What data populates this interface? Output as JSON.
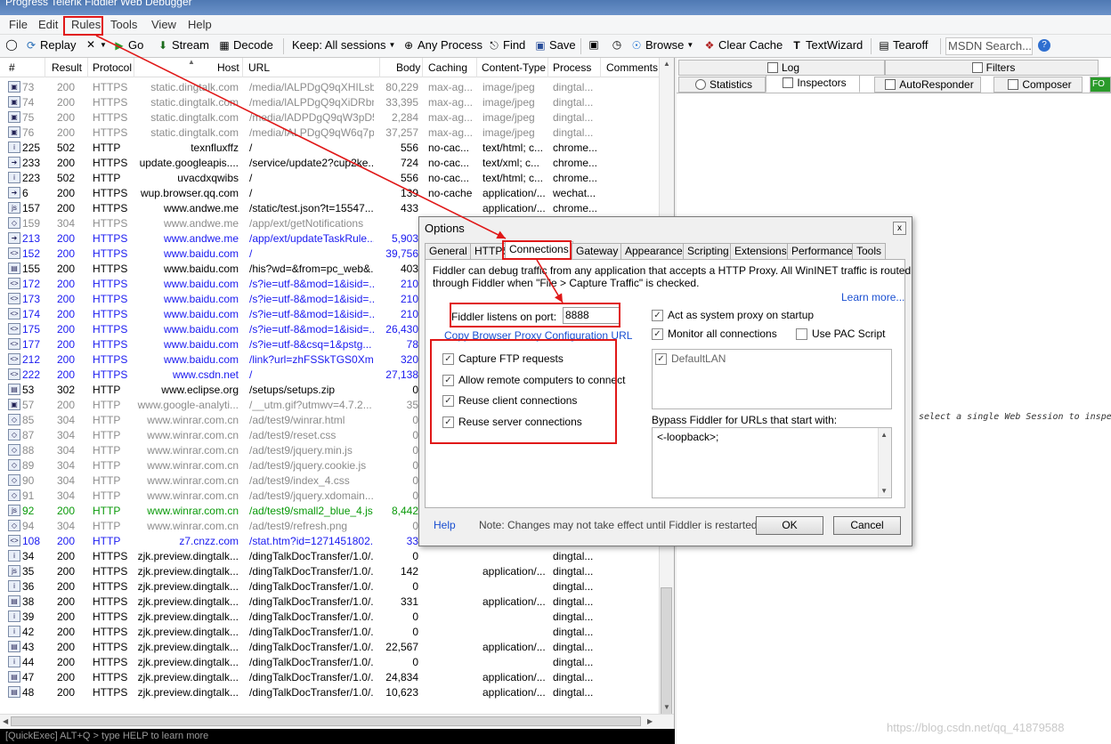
{
  "window": {
    "title": "Progress Telerik Fiddler Web Debugger"
  },
  "menu": [
    "File",
    "Edit",
    "Rules",
    "Tools",
    "View",
    "Help"
  ],
  "toolbar": {
    "replay": "Replay",
    "go": "Go",
    "stream": "Stream",
    "decode": "Decode",
    "keep": "Keep: All sessions",
    "process": "Any Process",
    "find": "Find",
    "save": "Save",
    "browse": "Browse",
    "clear_cache": "Clear Cache",
    "textwizard": "TextWizard",
    "tearoff": "Tearoff",
    "msdn": "MSDN Search..."
  },
  "columns": [
    "#",
    "Result",
    "Protocol",
    "Host",
    "URL",
    "Body",
    "Caching",
    "Content-Type",
    "Process",
    "Comments"
  ],
  "sessions": [
    {
      "num": "73",
      "result": "200",
      "protocol": "HTTPS",
      "host": "static.dingtalk.com",
      "url": "/media/lALPDgQ9qXHILsb...",
      "body": "80,229",
      "caching": "max-ag...",
      "ctype": "image/jpeg",
      "process": "dingtal...",
      "color": "gray",
      "icon": "img"
    },
    {
      "num": "74",
      "result": "200",
      "protocol": "HTTPS",
      "host": "static.dingtalk.com",
      "url": "/media/lALPDgQ9qXiDRbn...",
      "body": "33,395",
      "caching": "max-ag...",
      "ctype": "image/jpeg",
      "process": "dingtal...",
      "color": "gray",
      "icon": "img"
    },
    {
      "num": "75",
      "result": "200",
      "protocol": "HTTPS",
      "host": "static.dingtalk.com",
      "url": "/media/lADPDgQ9qW3pD5...",
      "body": "2,284",
      "caching": "max-ag...",
      "ctype": "image/jpeg",
      "process": "dingtal...",
      "color": "gray",
      "icon": "img"
    },
    {
      "num": "76",
      "result": "200",
      "protocol": "HTTPS",
      "host": "static.dingtalk.com",
      "url": "/media/lALPDgQ9qW6q7p...",
      "body": "37,257",
      "caching": "max-ag...",
      "ctype": "image/jpeg",
      "process": "dingtal...",
      "color": "gray",
      "icon": "img"
    },
    {
      "num": "225",
      "result": "502",
      "protocol": "HTTP",
      "host": "texnfluxffz",
      "url": "/",
      "body": "556",
      "caching": "no-cac...",
      "ctype": "text/html; c...",
      "process": "chrome...",
      "color": "black",
      "icon": "i"
    },
    {
      "num": "233",
      "result": "200",
      "protocol": "HTTPS",
      "host": "update.googleapis....",
      "url": "/service/update2?cup2ke...",
      "body": "724",
      "caching": "no-cac...",
      "ctype": "text/xml; c...",
      "process": "chrome...",
      "color": "black",
      "icon": "arrow"
    },
    {
      "num": "223",
      "result": "502",
      "protocol": "HTTP",
      "host": "uvacdxqwibs",
      "url": "/",
      "body": "556",
      "caching": "no-cac...",
      "ctype": "text/html; c...",
      "process": "chrome...",
      "color": "black",
      "icon": "i"
    },
    {
      "num": "6",
      "result": "200",
      "protocol": "HTTPS",
      "host": "wup.browser.qq.com",
      "url": "/",
      "body": "139",
      "caching": "no-cache",
      "ctype": "application/...",
      "process": "wechat...",
      "color": "black",
      "icon": "arrow"
    },
    {
      "num": "157",
      "result": "200",
      "protocol": "HTTPS",
      "host": "www.andwe.me",
      "url": "/static/test.json?t=15547...",
      "body": "433",
      "caching": "",
      "ctype": "application/...",
      "process": "chrome...",
      "color": "black",
      "icon": "js"
    },
    {
      "num": "159",
      "result": "304",
      "protocol": "HTTPS",
      "host": "www.andwe.me",
      "url": "/app/ext/getNotifications",
      "body": "",
      "caching": "",
      "ctype": "",
      "process": "",
      "color": "gray",
      "icon": "diamond"
    },
    {
      "num": "213",
      "result": "200",
      "protocol": "HTTPS",
      "host": "www.andwe.me",
      "url": "/app/ext/updateTaskRule...",
      "body": "5,903",
      "caching": "",
      "ctype": "",
      "process": "",
      "color": "blue",
      "icon": "arrow"
    },
    {
      "num": "152",
      "result": "200",
      "protocol": "HTTPS",
      "host": "www.baidu.com",
      "url": "/",
      "body": "39,756",
      "caching": "",
      "ctype": "",
      "process": "",
      "color": "blue",
      "icon": "code"
    },
    {
      "num": "155",
      "result": "200",
      "protocol": "HTTPS",
      "host": "www.baidu.com",
      "url": "/his?wd=&from=pc_web&...",
      "body": "403",
      "caching": "",
      "ctype": "",
      "process": "",
      "color": "black",
      "icon": "doc"
    },
    {
      "num": "172",
      "result": "200",
      "protocol": "HTTPS",
      "host": "www.baidu.com",
      "url": "/s?ie=utf-8&mod=1&isid=...",
      "body": "210",
      "caching": "",
      "ctype": "",
      "process": "",
      "color": "blue",
      "icon": "code"
    },
    {
      "num": "173",
      "result": "200",
      "protocol": "HTTPS",
      "host": "www.baidu.com",
      "url": "/s?ie=utf-8&mod=1&isid=...",
      "body": "210",
      "caching": "",
      "ctype": "",
      "process": "",
      "color": "blue",
      "icon": "code"
    },
    {
      "num": "174",
      "result": "200",
      "protocol": "HTTPS",
      "host": "www.baidu.com",
      "url": "/s?ie=utf-8&mod=1&isid=...",
      "body": "210",
      "caching": "",
      "ctype": "",
      "process": "",
      "color": "blue",
      "icon": "code"
    },
    {
      "num": "175",
      "result": "200",
      "protocol": "HTTPS",
      "host": "www.baidu.com",
      "url": "/s?ie=utf-8&mod=1&isid=...",
      "body": "26,430",
      "caching": "",
      "ctype": "",
      "process": "",
      "color": "blue",
      "icon": "code"
    },
    {
      "num": "177",
      "result": "200",
      "protocol": "HTTPS",
      "host": "www.baidu.com",
      "url": "/s?ie=utf-8&csq=1&pstg...",
      "body": "78",
      "caching": "",
      "ctype": "",
      "process": "",
      "color": "blue",
      "icon": "code"
    },
    {
      "num": "212",
      "result": "200",
      "protocol": "HTTPS",
      "host": "www.baidu.com",
      "url": "/link?url=zhFSSkTGS0XmG...",
      "body": "320",
      "caching": "",
      "ctype": "",
      "process": "",
      "color": "blue",
      "icon": "code"
    },
    {
      "num": "222",
      "result": "200",
      "protocol": "HTTPS",
      "host": "www.csdn.net",
      "url": "/",
      "body": "27,138",
      "caching": "",
      "ctype": "",
      "process": "",
      "color": "blue",
      "icon": "code"
    },
    {
      "num": "53",
      "result": "302",
      "protocol": "HTTP",
      "host": "www.eclipse.org",
      "url": "/setups/setups.zip",
      "body": "0",
      "caching": "",
      "ctype": "",
      "process": "",
      "color": "black",
      "icon": "doc"
    },
    {
      "num": "57",
      "result": "200",
      "protocol": "HTTP",
      "host": "www.google-analyti...",
      "url": "/__utm.gif?utmwv=4.7.2...",
      "body": "35",
      "caching": "",
      "ctype": "",
      "process": "",
      "color": "gray",
      "icon": "img"
    },
    {
      "num": "85",
      "result": "304",
      "protocol": "HTTP",
      "host": "www.winrar.com.cn",
      "url": "/ad/test9/winrar.html",
      "body": "0",
      "caching": "",
      "ctype": "",
      "process": "",
      "color": "gray",
      "icon": "diamond"
    },
    {
      "num": "87",
      "result": "304",
      "protocol": "HTTP",
      "host": "www.winrar.com.cn",
      "url": "/ad/test9/reset.css",
      "body": "0",
      "caching": "",
      "ctype": "",
      "process": "",
      "color": "gray",
      "icon": "diamond"
    },
    {
      "num": "88",
      "result": "304",
      "protocol": "HTTP",
      "host": "www.winrar.com.cn",
      "url": "/ad/test9/jquery.min.js",
      "body": "0",
      "caching": "",
      "ctype": "",
      "process": "",
      "color": "gray",
      "icon": "diamond"
    },
    {
      "num": "89",
      "result": "304",
      "protocol": "HTTP",
      "host": "www.winrar.com.cn",
      "url": "/ad/test9/jquery.cookie.js",
      "body": "0",
      "caching": "",
      "ctype": "",
      "process": "",
      "color": "gray",
      "icon": "diamond"
    },
    {
      "num": "90",
      "result": "304",
      "protocol": "HTTP",
      "host": "www.winrar.com.cn",
      "url": "/ad/test9/index_4.css",
      "body": "0",
      "caching": "",
      "ctype": "",
      "process": "",
      "color": "gray",
      "icon": "diamond"
    },
    {
      "num": "91",
      "result": "304",
      "protocol": "HTTP",
      "host": "www.winrar.com.cn",
      "url": "/ad/test9/jquery.xdomain...",
      "body": "0",
      "caching": "",
      "ctype": "",
      "process": "",
      "color": "gray",
      "icon": "diamond"
    },
    {
      "num": "92",
      "result": "200",
      "protocol": "HTTP",
      "host": "www.winrar.com.cn",
      "url": "/ad/test9/small2_blue_4.js",
      "body": "8,442",
      "caching": "",
      "ctype": "",
      "process": "",
      "color": "green",
      "icon": "js"
    },
    {
      "num": "94",
      "result": "304",
      "protocol": "HTTP",
      "host": "www.winrar.com.cn",
      "url": "/ad/test9/refresh.png",
      "body": "0",
      "caching": "",
      "ctype": "",
      "process": "",
      "color": "gray",
      "icon": "diamond"
    },
    {
      "num": "108",
      "result": "200",
      "protocol": "HTTP",
      "host": "z7.cnzz.com",
      "url": "/stat.htm?id=1271451802...",
      "body": "33",
      "caching": "",
      "ctype": "",
      "process": "",
      "color": "blue",
      "icon": "code"
    },
    {
      "num": "34",
      "result": "200",
      "protocol": "HTTPS",
      "host": "zjk.preview.dingtalk...",
      "url": "/dingTalkDocTransfer/1.0/...",
      "body": "0",
      "caching": "",
      "ctype": "",
      "process": "dingtal...",
      "color": "black",
      "icon": "i"
    },
    {
      "num": "35",
      "result": "200",
      "protocol": "HTTPS",
      "host": "zjk.preview.dingtalk...",
      "url": "/dingTalkDocTransfer/1.0/...",
      "body": "142",
      "caching": "",
      "ctype": "application/...",
      "process": "dingtal...",
      "color": "black",
      "icon": "js"
    },
    {
      "num": "36",
      "result": "200",
      "protocol": "HTTPS",
      "host": "zjk.preview.dingtalk...",
      "url": "/dingTalkDocTransfer/1.0/...",
      "body": "0",
      "caching": "",
      "ctype": "",
      "process": "dingtal...",
      "color": "black",
      "icon": "i"
    },
    {
      "num": "38",
      "result": "200",
      "protocol": "HTTPS",
      "host": "zjk.preview.dingtalk...",
      "url": "/dingTalkDocTransfer/1.0/...",
      "body": "331",
      "caching": "",
      "ctype": "application/...",
      "process": "dingtal...",
      "color": "black",
      "icon": "doc"
    },
    {
      "num": "39",
      "result": "200",
      "protocol": "HTTPS",
      "host": "zjk.preview.dingtalk...",
      "url": "/dingTalkDocTransfer/1.0/...",
      "body": "0",
      "caching": "",
      "ctype": "",
      "process": "dingtal...",
      "color": "black",
      "icon": "i"
    },
    {
      "num": "42",
      "result": "200",
      "protocol": "HTTPS",
      "host": "zjk.preview.dingtalk...",
      "url": "/dingTalkDocTransfer/1.0/...",
      "body": "0",
      "caching": "",
      "ctype": "",
      "process": "dingtal...",
      "color": "black",
      "icon": "i"
    },
    {
      "num": "43",
      "result": "200",
      "protocol": "HTTPS",
      "host": "zjk.preview.dingtalk...",
      "url": "/dingTalkDocTransfer/1.0/...",
      "body": "22,567",
      "caching": "",
      "ctype": "application/...",
      "process": "dingtal...",
      "color": "black",
      "icon": "doc"
    },
    {
      "num": "44",
      "result": "200",
      "protocol": "HTTPS",
      "host": "zjk.preview.dingtalk...",
      "url": "/dingTalkDocTransfer/1.0/...",
      "body": "0",
      "caching": "",
      "ctype": "",
      "process": "dingtal...",
      "color": "black",
      "icon": "i"
    },
    {
      "num": "47",
      "result": "200",
      "protocol": "HTTPS",
      "host": "zjk.preview.dingtalk...",
      "url": "/dingTalkDocTransfer/1.0/...",
      "body": "24,834",
      "caching": "",
      "ctype": "application/...",
      "process": "dingtal...",
      "color": "black",
      "icon": "doc"
    },
    {
      "num": "48",
      "result": "200",
      "protocol": "HTTPS",
      "host": "zjk.preview.dingtalk...",
      "url": "/dingTalkDocTransfer/1.0/...",
      "body": "10,623",
      "caching": "",
      "ctype": "application/...",
      "process": "dingtal...",
      "color": "black",
      "icon": "doc"
    }
  ],
  "quickexec": "[QuickExec] ALT+Q > type HELP to learn more",
  "right_tabs": {
    "log": "Log",
    "filters": "Filters",
    "statistics": "Statistics",
    "inspectors": "Inspectors",
    "autoresponder": "AutoResponder",
    "composer": "Composer",
    "fo": "FO"
  },
  "right_hint": "select a single Web Session to inspe",
  "watermark": "https://blog.csdn.net/qq_41879588",
  "dialog": {
    "title": "Options",
    "close": "x",
    "tabs": [
      "General",
      "HTTPS",
      "Connections",
      "Gateway",
      "Appearance",
      "Scripting",
      "Extensions",
      "Performance",
      "Tools"
    ],
    "desc1": "Fiddler can debug traffic from any application that accepts a HTTP Proxy. All WinINET traffic is routed",
    "desc2": "through Fiddler when \"File > Capture Traffic\" is checked.",
    "learn_more": "Learn more...",
    "port_label": "Fiddler listens on port:",
    "port_value": "8888",
    "copy_link": "Copy Browser Proxy Configuration URL",
    "left_options": [
      "Capture FTP requests",
      "Allow remote computers to connect",
      "Reuse client connections",
      "Reuse server connections"
    ],
    "act_as_proxy": "Act as system proxy on startup",
    "monitor_all": "Monitor all connections",
    "use_pac": "Use PAC Script",
    "lan": "DefaultLAN",
    "bypass_label": "Bypass Fiddler for URLs that start with:",
    "bypass_value": "<-loopback>;",
    "help": "Help",
    "note": "Note: Changes may not take effect until Fiddler is restarted.",
    "ok": "OK",
    "cancel": "Cancel"
  },
  "colors": {
    "annotation": "#e01818",
    "link": "#1a4fd1",
    "blue_row": "#1a1af0",
    "green_row": "#0a9a0a",
    "gray_row": "#8c8c8c"
  }
}
